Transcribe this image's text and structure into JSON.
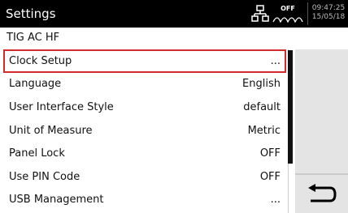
{
  "header": {
    "title": "Settings",
    "status_label": "OFF",
    "time": "09:47:25",
    "date": "15/05/18"
  },
  "subtitle": "TIG AC HF",
  "menu": {
    "items": [
      {
        "label": "Clock Setup",
        "value": "..."
      },
      {
        "label": "Language",
        "value": "English"
      },
      {
        "label": "User Interface Style",
        "value": "default"
      },
      {
        "label": "Unit of Measure",
        "value": "Metric"
      },
      {
        "label": "Panel Lock",
        "value": "OFF"
      },
      {
        "label": "Use PIN Code",
        "value": "OFF"
      },
      {
        "label": "USB Management",
        "value": "..."
      }
    ],
    "selected_index": 0
  },
  "icons": {
    "network": "network-icon",
    "wave": "wave-icon",
    "back": "back-arrow-icon"
  },
  "colors": {
    "header_bg": "#000000",
    "selection_border": "#d32c2c",
    "panel_bg": "#e4e4e4"
  }
}
